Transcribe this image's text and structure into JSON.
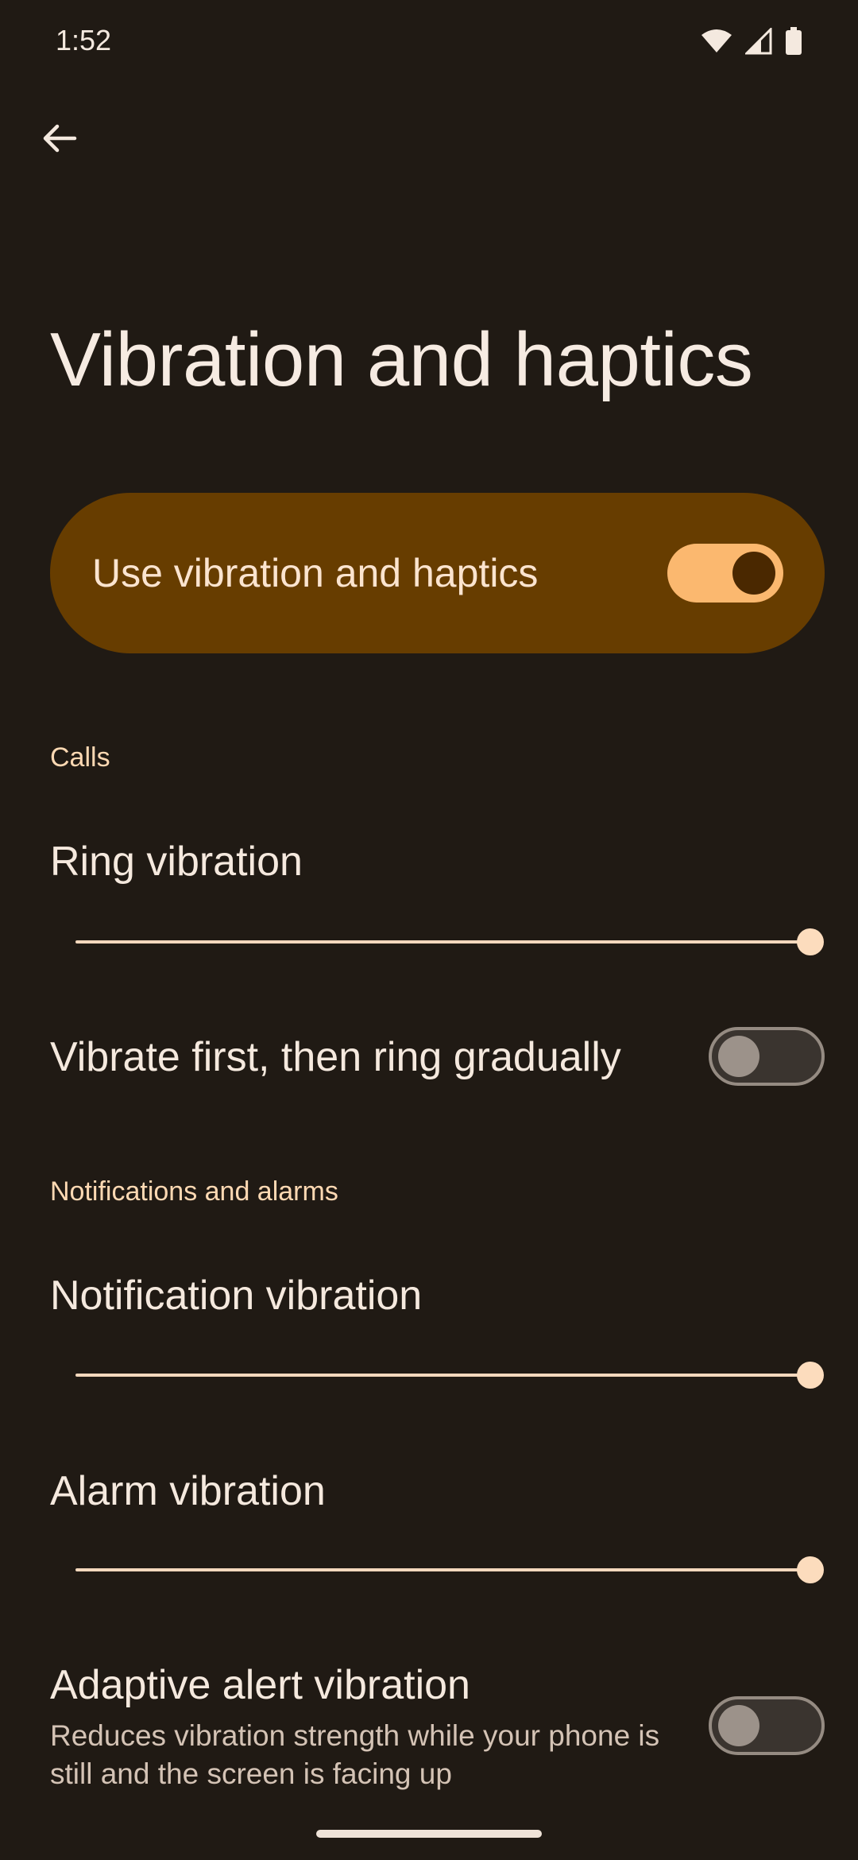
{
  "status_bar": {
    "time": "1:52",
    "icons": [
      "wifi-icon",
      "cell-signal-icon",
      "battery-icon"
    ]
  },
  "header": {
    "back_icon": "arrow-back-icon",
    "title": "Vibration and haptics"
  },
  "main_toggle": {
    "label": "Use vibration and haptics",
    "checked": true
  },
  "sections": {
    "calls": {
      "header": "Calls",
      "ring_vibration": {
        "label": "Ring vibration",
        "level": 1.0
      },
      "vibrate_first": {
        "label": "Vibrate first, then ring gradually",
        "checked": false
      }
    },
    "notifications": {
      "header": "Notifications and alarms",
      "notification_vibration": {
        "label": "Notification vibration",
        "level": 1.0
      },
      "alarm_vibration": {
        "label": "Alarm vibration",
        "level": 1.0
      },
      "adaptive": {
        "label": "Adaptive alert vibration",
        "summary": "Reduces vibration strength while your phone is still and the screen is facing up",
        "checked": false
      }
    }
  },
  "colors": {
    "background": "#201a14",
    "card": "#673d00",
    "accent": "#fbb86f",
    "slider": "#fcdcbd",
    "section_header": "#ffd9b3"
  }
}
